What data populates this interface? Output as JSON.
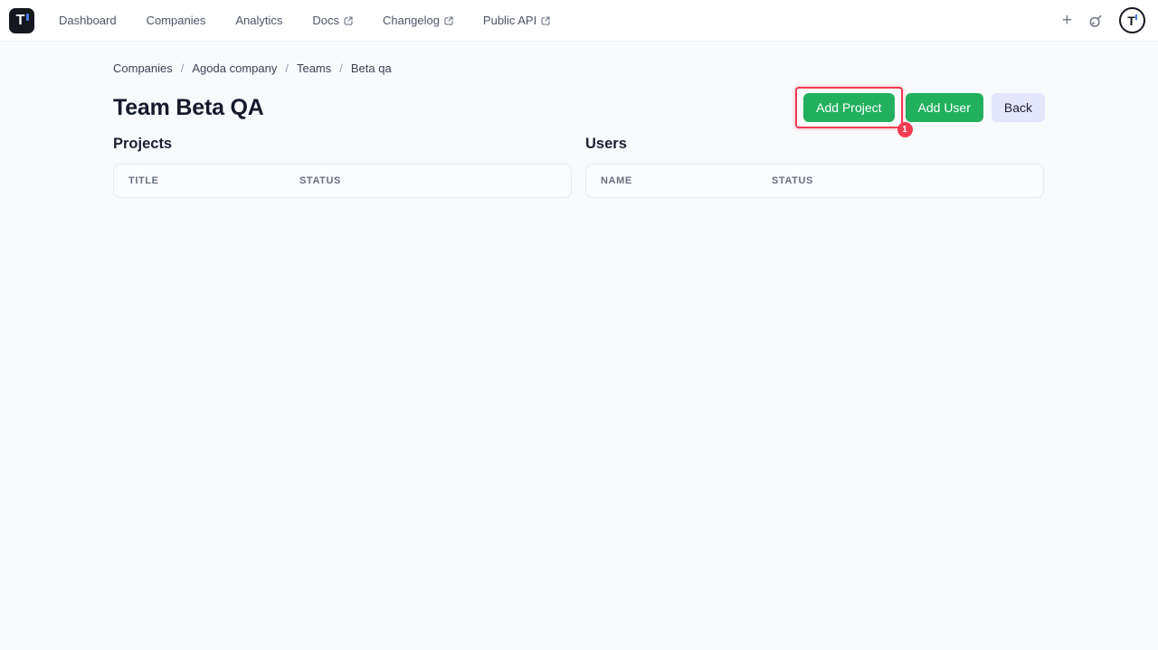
{
  "topnav": {
    "brand_letter": "T",
    "items": [
      {
        "label": "Dashboard"
      },
      {
        "label": "Companies"
      },
      {
        "label": "Analytics"
      },
      {
        "label": "Docs"
      },
      {
        "label": "Changelog"
      },
      {
        "label": "Public API"
      }
    ],
    "plus_label": "+"
  },
  "breadcrumb": {
    "separator": "/",
    "items": [
      "Companies",
      "Agoda company",
      "Teams",
      "Beta qa"
    ]
  },
  "page": {
    "title": "Team Beta QA",
    "buttons": {
      "add_project": "Add Project",
      "add_user": "Add User",
      "back": "Back"
    }
  },
  "annotation": {
    "step_badge": "1"
  },
  "projects": {
    "heading": "Projects",
    "columns": {
      "col1": "TITLE",
      "col2": "STATUS"
    },
    "rows": []
  },
  "users": {
    "heading": "Users",
    "columns": {
      "col1": "NAME",
      "col2": "STATUS"
    },
    "rows": []
  },
  "colors": {
    "primary_green": "#22b05e",
    "back_button_bg": "#e4e7fc",
    "annotation_red": "#f43b53",
    "brand_blue": "#4b7ae8"
  }
}
